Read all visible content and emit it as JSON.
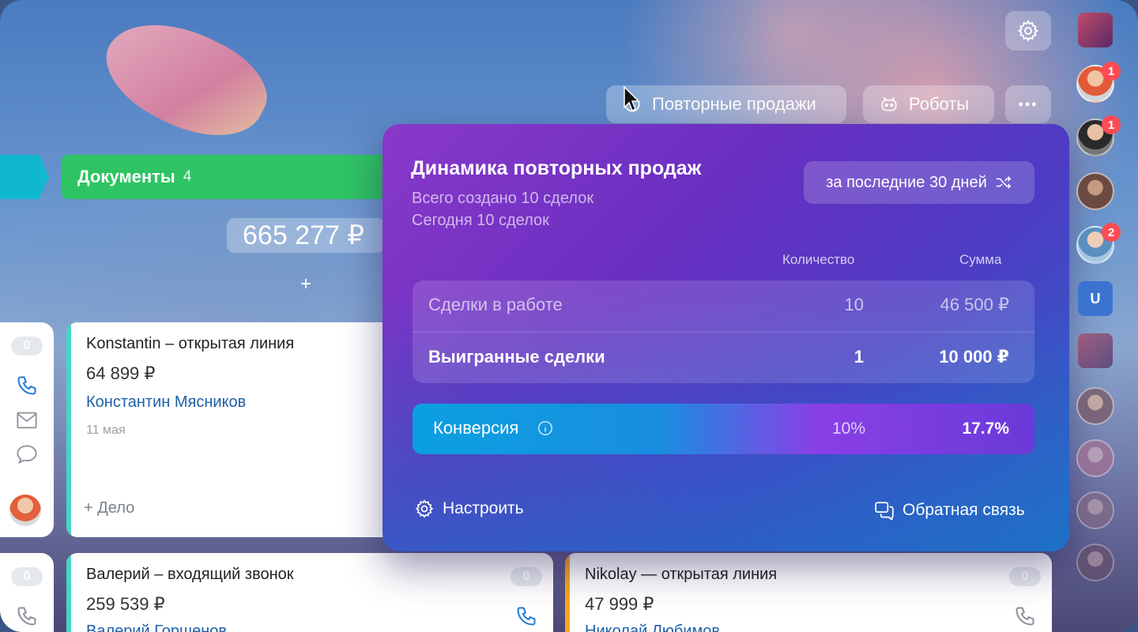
{
  "toolbar": {
    "repeat_sales_label": "Повторные продажи",
    "robots_label": "Роботы",
    "more_label": "•••"
  },
  "pipeline": {
    "docs_stage_label": "Документы",
    "docs_stage_count": "4",
    "docs_stage_sum": "665 277 ₽",
    "add_label": "+"
  },
  "cards": [
    {
      "title": "Konstantin – открытая линия",
      "price": "64 899 ₽",
      "contact": "Константин Мясников",
      "date": "11 мая",
      "add_task": "+ Дело",
      "bar_color": "#46d6c6"
    },
    {
      "title": "Валерий – входящий звонок",
      "price": "259 539 ₽",
      "contact": "Валерий Горшенов",
      "badge": "0",
      "bar_color": "#46d6c6"
    },
    {
      "title": "Nikolay — открытая линия",
      "price": "47 999 ₽",
      "contact": "Николай Любимов",
      "badge": "0",
      "bar_color": "#f5a623"
    }
  ],
  "side_badges": [
    "0",
    "0"
  ],
  "popup": {
    "title": "Динамика повторных продаж",
    "total_created": "Всего создано 10 сделок",
    "today": "Сегодня 10 сделок",
    "period": "за последние 30 дней",
    "col_quantity": "Количество",
    "col_sum": "Сумма",
    "rows": [
      {
        "label": "Сделки в работе",
        "quantity": "10",
        "sum": "46 500 ₽"
      },
      {
        "label": "Выигранные сделки",
        "quantity": "1",
        "sum": "10 000 ₽"
      }
    ],
    "conversion": {
      "label": "Конверсия",
      "quantity": "10%",
      "sum": "17.7%"
    },
    "configure": "Настроить",
    "feedback": "Обратная связь"
  },
  "avatars": [
    {
      "badge": "1"
    },
    {
      "badge": "1"
    },
    {
      "badge": ""
    },
    {
      "badge": "2"
    }
  ],
  "colors": {
    "green_stage": "#2fc463",
    "blue_stage": "#10b8cf",
    "link": "#1e5fa8",
    "badge": "#ff4b55"
  }
}
